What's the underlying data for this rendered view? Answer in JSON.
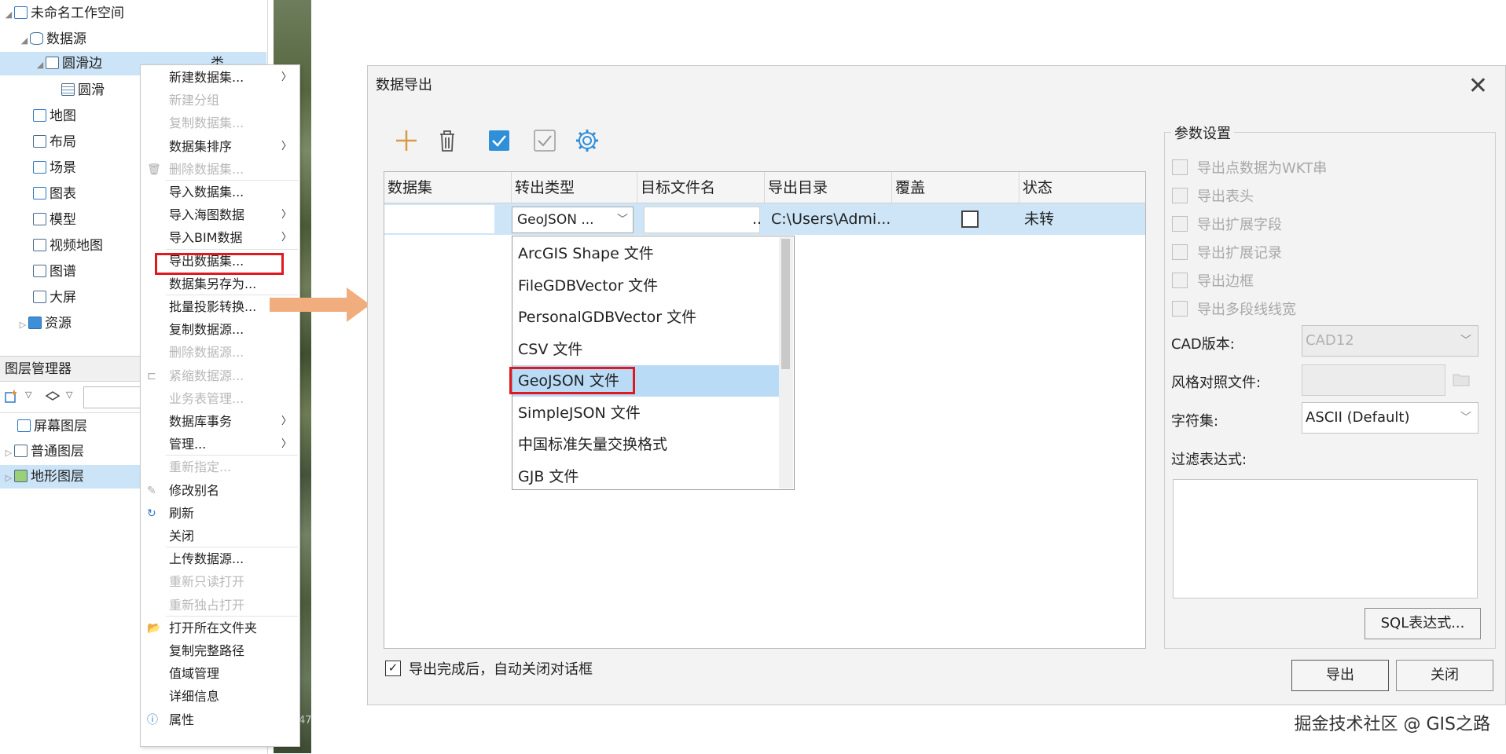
{
  "workspace": {
    "root": "未命名工作空间",
    "datasources": "数据源",
    "datasource_item": "圆滑边",
    "datasource_item_tail": "类",
    "dataset_item": "圆滑",
    "maps": "地图",
    "layouts": "布局",
    "scenes": "场景",
    "charts": "图表",
    "models": "模型",
    "video_maps": "视频地图",
    "graphs": "图谱",
    "screens": "大屏",
    "resources": "资源"
  },
  "layer_manager": {
    "title": "图层管理器",
    "layers": [
      "屏幕图层",
      "普通图层",
      "地形图层"
    ]
  },
  "imagery_text": "47",
  "context_menu": {
    "items": [
      {
        "label": "新建数据集...",
        "disabled": false,
        "submenu": true
      },
      {
        "label": "新建分组",
        "disabled": true,
        "submenu": false
      },
      {
        "label": "复制数据集...",
        "disabled": true,
        "submenu": false
      },
      {
        "label": "数据集排序",
        "disabled": false,
        "submenu": true
      },
      {
        "label": "删除数据集...",
        "disabled": true,
        "submenu": false
      },
      {
        "label": "导入数据集...",
        "disabled": false,
        "submenu": false
      },
      {
        "label": "导入海图数据",
        "disabled": false,
        "submenu": true
      },
      {
        "label": "导入BIM数据",
        "disabled": false,
        "submenu": true
      },
      {
        "label": "导出数据集...",
        "disabled": false,
        "submenu": false
      },
      {
        "label": "数据集另存为...",
        "disabled": false,
        "submenu": false
      },
      {
        "label": "批量投影转换...",
        "disabled": false,
        "submenu": false
      },
      {
        "label": "复制数据源...",
        "disabled": false,
        "submenu": false
      },
      {
        "label": "删除数据源...",
        "disabled": true,
        "submenu": false
      },
      {
        "label": "紧缩数据源...",
        "disabled": true,
        "submenu": false
      },
      {
        "label": "业务表管理...",
        "disabled": true,
        "submenu": false
      },
      {
        "label": "数据库事务",
        "disabled": false,
        "submenu": true
      },
      {
        "label": "管理...",
        "disabled": false,
        "submenu": true
      },
      {
        "label": "重新指定...",
        "disabled": true,
        "submenu": false
      },
      {
        "label": "修改别名",
        "disabled": false,
        "submenu": false
      },
      {
        "label": "刷新",
        "disabled": false,
        "submenu": false
      },
      {
        "label": "关闭",
        "disabled": false,
        "submenu": false
      },
      {
        "label": "上传数据源...",
        "disabled": false,
        "submenu": false
      },
      {
        "label": "重新只读打开",
        "disabled": true,
        "submenu": false
      },
      {
        "label": "重新独占打开",
        "disabled": true,
        "submenu": false
      },
      {
        "label": "打开所在文件夹",
        "disabled": false,
        "submenu": false
      },
      {
        "label": "复制完整路径",
        "disabled": false,
        "submenu": false
      },
      {
        "label": "值域管理",
        "disabled": false,
        "submenu": false
      },
      {
        "label": "详细信息",
        "disabled": false,
        "submenu": false
      },
      {
        "label": "属性",
        "disabled": false,
        "submenu": false
      }
    ]
  },
  "dialog": {
    "title": "数据导出",
    "grid": {
      "headers": [
        "数据集",
        "转出类型",
        "目标文件名",
        "导出目录",
        "覆盖",
        "状态"
      ],
      "row": {
        "dataset": "",
        "type": "GeoJSON ...",
        "filename": "",
        "filename_tail": "..",
        "directory": "C:\\Users\\Admi...",
        "overwrite": false,
        "status": "未转"
      }
    },
    "type_options": [
      "ArcGIS Shape 文件",
      "FileGDBVector 文件",
      "PersonalGDBVector 文件",
      "CSV 文件",
      "GeoJSON 文件",
      "SimpleJSON 文件",
      "中国标准矢量交换格式",
      "GJB 文件"
    ],
    "selected_option": "GeoJSON 文件",
    "params": {
      "legend": "参数设置",
      "checks": [
        "导出点数据为WKT串",
        "导出表头",
        "导出扩展字段",
        "导出扩展记录",
        "导出边框",
        "导出多段线线宽"
      ],
      "cad_version_label": "CAD版本:",
      "cad_version_value": "CAD12",
      "style_file_label": "风格对照文件:",
      "charset_label": "字符集:",
      "charset_value": "ASCII (Default)",
      "filter_label": "过滤表达式:",
      "sql_button": "SQL表达式..."
    },
    "auto_close_label": "导出完成后，自动关闭对话框",
    "auto_close_checked": true,
    "export_button": "导出",
    "close_button": "关闭"
  },
  "watermark": "掘金技术社区 @ GIS之路",
  "colors": {
    "highlight_red": "#e0181f",
    "selection_blue": "#cde5f7",
    "arrow_orange": "#f2ad7e"
  }
}
